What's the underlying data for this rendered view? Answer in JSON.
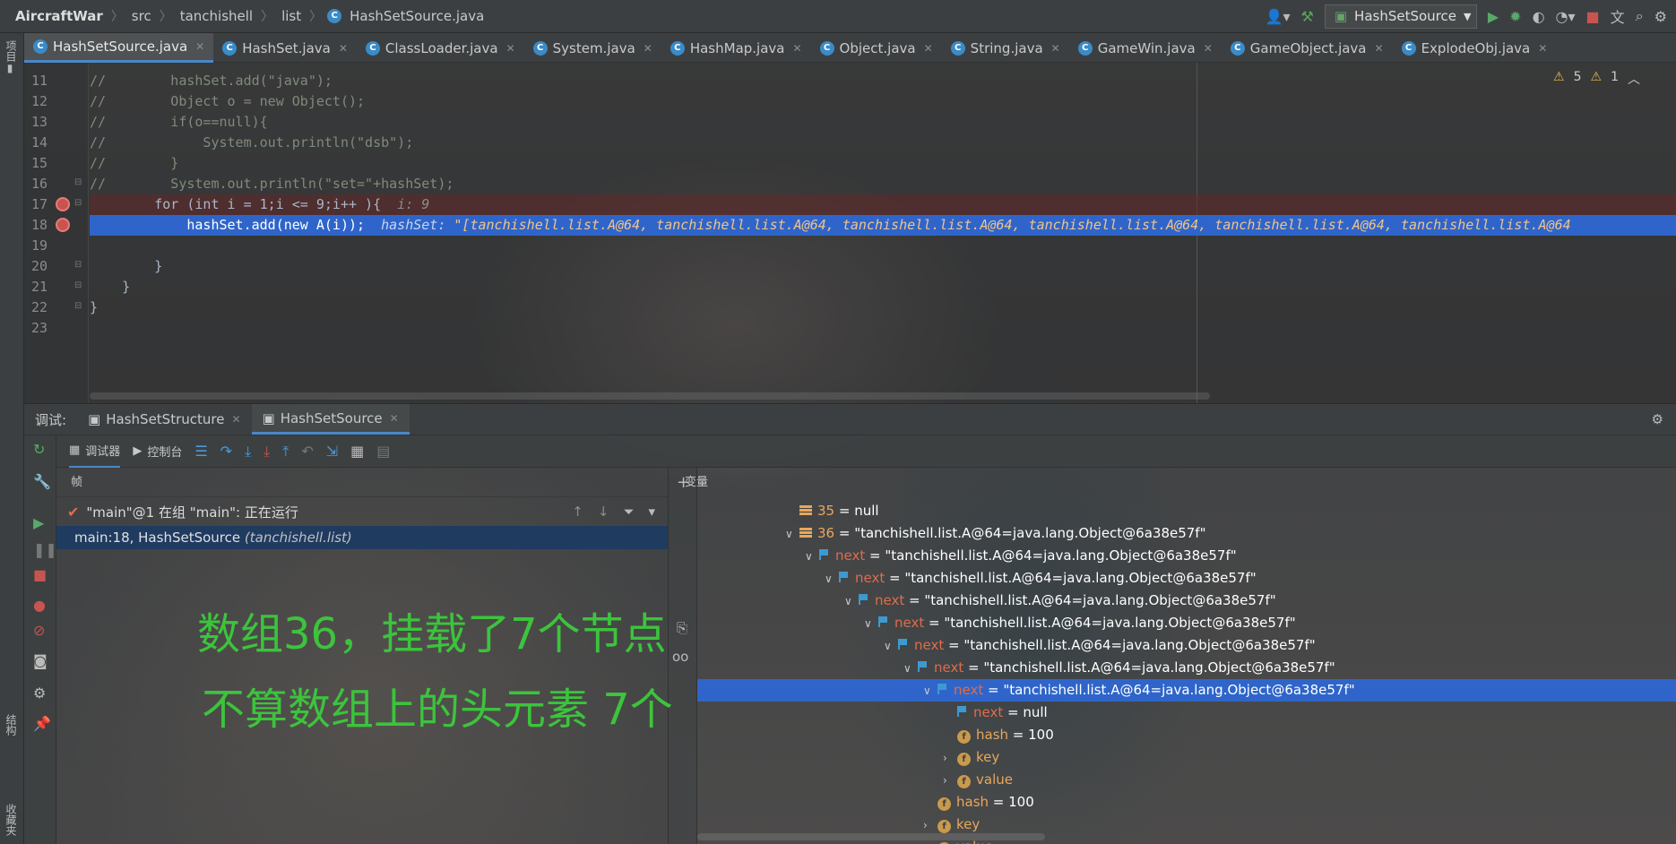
{
  "topbar": {
    "breadcrumbs": [
      "AircraftWar",
      "src",
      "tanchishell",
      "list",
      "HashSetSource.java"
    ],
    "run_config": "HashSetSource"
  },
  "left_strip": {
    "project_label": "项目",
    "structure_label": "结构",
    "favorites_label": "收藏夹"
  },
  "tabs": [
    {
      "label": "HashSetSource.java",
      "active": true
    },
    {
      "label": "HashSet.java"
    },
    {
      "label": "ClassLoader.java"
    },
    {
      "label": "System.java"
    },
    {
      "label": "HashMap.java"
    },
    {
      "label": "Object.java"
    },
    {
      "label": "String.java"
    },
    {
      "label": "GameWin.java"
    },
    {
      "label": "GameObject.java"
    },
    {
      "label": "ExplodeObj.java"
    }
  ],
  "inspections": {
    "warnings": "5",
    "weak_warnings": "1"
  },
  "code": {
    "line_numbers": [
      "11",
      "12",
      "13",
      "14",
      "15",
      "16",
      "17",
      "18",
      "19",
      "20",
      "21",
      "22",
      "23"
    ],
    "lines": [
      "//        hashSet.add(\"java\");",
      "//        Object o = new Object();",
      "//        if(o==null){",
      "//            System.out.println(\"dsb\");",
      "//        }",
      "//        System.out.println(\"set=\"+hashSet);",
      "        for (int i = 1;i <= 9;i++ ){",
      "            hashSet.add(new A(i));",
      "",
      "        }",
      "    }",
      "}",
      ""
    ],
    "line17_hint": "i: 9",
    "line18_hint_name": "hashSet:",
    "line18_hint_value": "\"[tanchishell.list.A@64, tanchishell.list.A@64, tanchishell.list.A@64, tanchishell.list.A@64, tanchishell.list.A@64, tanchishell.list.A@64"
  },
  "debug": {
    "label": "调试:",
    "tabs": [
      {
        "label": "HashSetStructure"
      },
      {
        "label": "HashSetSource",
        "active": true
      }
    ],
    "toolbar": {
      "debugger": "调试器",
      "console": "控制台"
    },
    "frames_header": "帧",
    "thread": "\"main\"@1 在组 \"main\": 正在运行",
    "frame": "main:18, HashSetSource",
    "frame_pkg": "(tanchishell.list)",
    "variables_header": "变量"
  },
  "annotation": {
    "line1": "数组36，挂载了7个节点",
    "line2": "不算数组上的头元素 7个"
  },
  "variables": [
    {
      "indent": 0,
      "arrow": "",
      "icon": "arr",
      "name": "35",
      "value": " = null"
    },
    {
      "indent": 0,
      "arrow": "open",
      "icon": "arr",
      "name": "36",
      "value": " = \"tanchishell.list.A@64=java.lang.Object@6a38e57f\""
    },
    {
      "indent": 1,
      "arrow": "open",
      "icon": "flag",
      "name": "next",
      "value": " = \"tanchishell.list.A@64=java.lang.Object@6a38e57f\""
    },
    {
      "indent": 2,
      "arrow": "open",
      "icon": "flag",
      "name": "next",
      "value": " = \"tanchishell.list.A@64=java.lang.Object@6a38e57f\""
    },
    {
      "indent": 3,
      "arrow": "open",
      "icon": "flag",
      "name": "next",
      "value": " = \"tanchishell.list.A@64=java.lang.Object@6a38e57f\""
    },
    {
      "indent": 4,
      "arrow": "open",
      "icon": "flag",
      "name": "next",
      "value": " = \"tanchishell.list.A@64=java.lang.Object@6a38e57f\""
    },
    {
      "indent": 5,
      "arrow": "open",
      "icon": "flag",
      "name": "next",
      "value": " = \"tanchishell.list.A@64=java.lang.Object@6a38e57f\""
    },
    {
      "indent": 6,
      "arrow": "open",
      "icon": "flag",
      "name": "next",
      "value": " = \"tanchishell.list.A@64=java.lang.Object@6a38e57f\""
    },
    {
      "indent": 7,
      "arrow": "open",
      "icon": "flag",
      "name": "next",
      "value": " = \"tanchishell.list.A@64=java.lang.Object@6a38e57f\"",
      "selected": true
    },
    {
      "indent": 8,
      "arrow": "",
      "icon": "flag",
      "name": "next",
      "value": " = null"
    },
    {
      "indent": 8,
      "arrow": "",
      "icon": "f",
      "name": "hash",
      "value": " = 100"
    },
    {
      "indent": 8,
      "arrow": "closed",
      "icon": "f",
      "name": "key",
      "value": ""
    },
    {
      "indent": 8,
      "arrow": "closed",
      "icon": "f",
      "name": "value",
      "value": ""
    },
    {
      "indent": 7,
      "arrow": "",
      "icon": "f",
      "name": "hash",
      "value": " = 100"
    },
    {
      "indent": 7,
      "arrow": "closed",
      "icon": "f",
      "name": "key",
      "value": ""
    },
    {
      "indent": 7,
      "arrow": "closed",
      "icon": "f",
      "name": "value",
      "value": ""
    }
  ]
}
